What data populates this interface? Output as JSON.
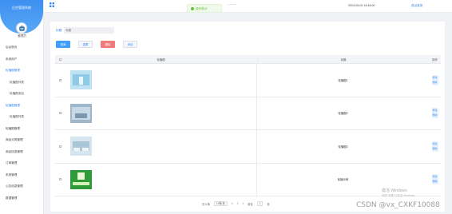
{
  "sidebar": {
    "brand_title": "后台管理系统",
    "user_label": "管理员",
    "items": [
      {
        "label": "后台首页",
        "level": 1,
        "active": false
      },
      {
        "label": "系统用户",
        "level": 1,
        "active": false
      },
      {
        "label": "轮播图管理",
        "level": 1,
        "active": true
      },
      {
        "label": "轮播图列表",
        "level": 2,
        "active": false
      },
      {
        "label": "轮播图添加",
        "level": 2,
        "active": false
      },
      {
        "label": "轮播图管理",
        "level": 1,
        "active": true
      },
      {
        "label": "轮播图列表",
        "level": 2,
        "active": false
      },
      {
        "label": "轮播图管理",
        "level": 1,
        "active": false
      },
      {
        "label": "商品分类管理",
        "level": 1,
        "active": false
      },
      {
        "label": "商品信息管理",
        "level": 1,
        "active": false
      },
      {
        "label": "订单管理",
        "level": 1,
        "active": false
      },
      {
        "label": "系统管理",
        "level": 1,
        "active": false
      },
      {
        "label": "公告信息管理",
        "level": 1,
        "active": false
      },
      {
        "label": "数据管理",
        "level": 1,
        "active": false
      }
    ]
  },
  "topbar": {
    "title_tail": "- - - - -",
    "datetime": "2024-05-04 14:46:00",
    "logout": "退出登录"
  },
  "toast": {
    "message": "操作成功!"
  },
  "search": {
    "label": "标题",
    "placeholder": "标题"
  },
  "buttons": {
    "search": "查询",
    "reset": "重置",
    "delete": "删除",
    "add": "添加"
  },
  "table": {
    "headers": {
      "image": "轮播图",
      "title": "标题",
      "op": "操作"
    },
    "rows": [
      {
        "title": "轮播图1",
        "thumb": "clinic-blue"
      },
      {
        "title": "轮播图2",
        "thumb": "hall-gray"
      },
      {
        "title": "轮播图3",
        "thumb": "ward-white"
      },
      {
        "title": "轮播示例",
        "thumb": "green-poster"
      }
    ],
    "op_labels": {
      "edit": "修改",
      "del": "删除"
    }
  },
  "pager": {
    "total": "共 4 条",
    "size": "10条/页",
    "prev": "<",
    "page": "1",
    "next": ">",
    "goto": "前往",
    "goto_page": "1",
    "goto_unit": "页"
  },
  "watermark": {
    "win_title": "激活 Windows",
    "win_sub": "转到\"设置\"以激活 Windows。",
    "csdn": "CSDN @vx_CXKF10088"
  },
  "colors": {
    "accent": "#409eff",
    "danger": "#f07b7b",
    "success": "#67c23a"
  }
}
